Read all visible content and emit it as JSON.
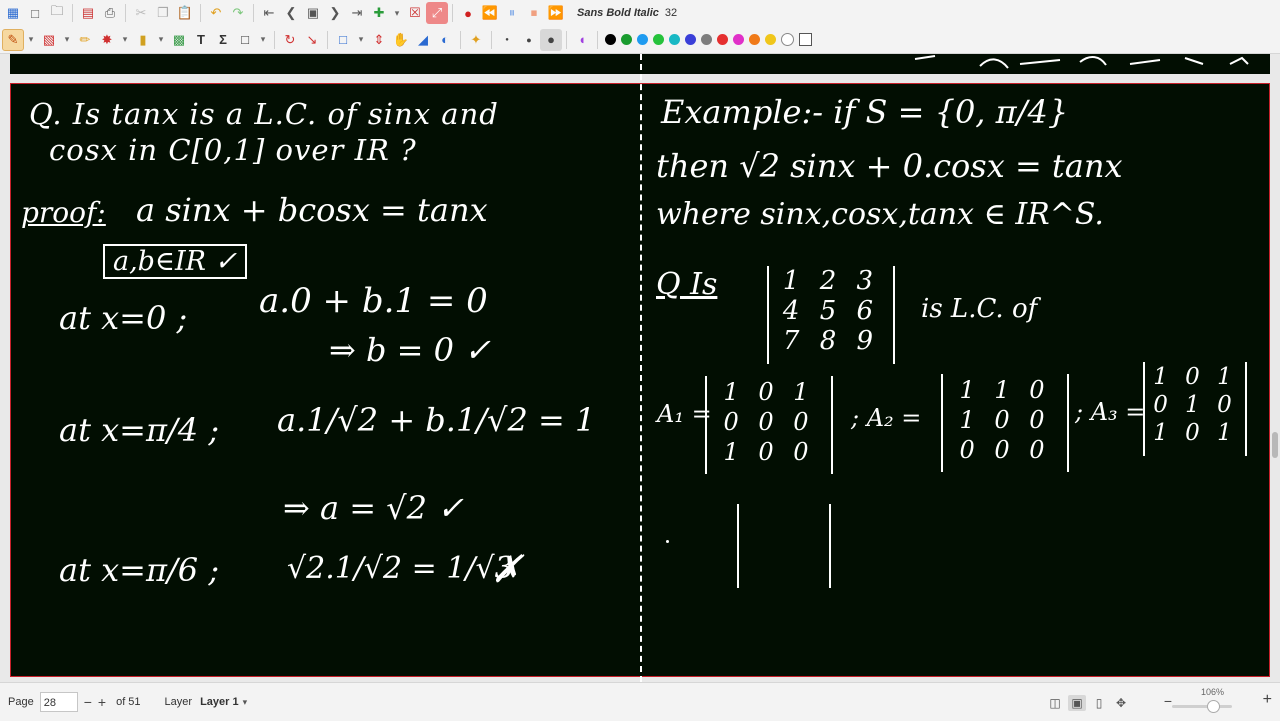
{
  "toolbar": {
    "font_name": "Sans Bold Italic",
    "font_size": "32",
    "colors": [
      "#000000",
      "#1a9c2f",
      "#1e9bf0",
      "#25c23b",
      "#18b8c4",
      "#3a3fd8",
      "#7d7d7d",
      "#e52f2f",
      "#e030c8",
      "#f07a18",
      "#f0c61a",
      "#ffffff",
      "#ffffff"
    ]
  },
  "board": {
    "left": {
      "q1_line1": "Q. Is tanx is a L.C. of sinx and",
      "q1_line2": "cosx in C[0,1] over IR ?",
      "proof_label": "proof:",
      "proof_eq": "a sinx + bcosx = tanx",
      "boxed": "a,b∈IR ✓",
      "at_x0_label": "at x=0 ;",
      "at_x0_eq": "a.0 + b.1 = 0",
      "b_result": "⇒ b = 0 ✓",
      "at_pi4_label": "at x=π/4 ;",
      "at_pi4_eq": "a.1/√2 + b.1/√2 = 1",
      "a_result": "⇒ a = √2 ✓",
      "at_pi6_label": "at x=π/6 ;",
      "at_pi6_eq": "√2.1/√2 = 1/√3",
      "cross": "✗"
    },
    "right": {
      "example_line": "Example:- if S = {0, π/4}",
      "then_line": "then √2 sinx + 0.cosx = tanx",
      "where_line": "where sinx,cosx,tanx ∈ IR^S.",
      "q2_label": "Q Is",
      "matrix_main": [
        "1 2 3",
        "4 5 6",
        "7 8 9"
      ],
      "is_lc_of": "is L.C. of",
      "a1_label": "A₁ =",
      "a1": [
        "1 0 1",
        "0 0 0",
        "1 0 0"
      ],
      "a2_label": "; A₂ =",
      "a2": [
        "1 1 0",
        "1 0 0",
        "0 0 0"
      ],
      "a3_label": "; A₃ =",
      "a3": [
        "1 0 1",
        "0 1 0",
        "1 0 1"
      ]
    }
  },
  "status": {
    "page_label": "Page",
    "page_value": "28",
    "of_pages": "of 51",
    "layer_label": "Layer",
    "layer_value": "Layer 1",
    "zoom": "106%"
  }
}
